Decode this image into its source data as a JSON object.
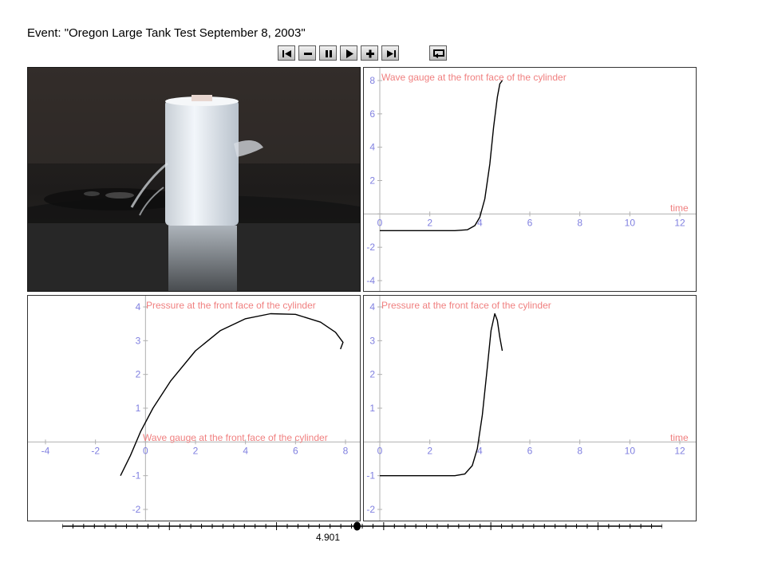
{
  "event_title": "Event: \"Oregon Large Tank Test September 8, 2003\"",
  "toolbar": {
    "buttons": [
      {
        "name": "skip-to-start-button",
        "icon": "skip-start-icon"
      },
      {
        "name": "step-back-button",
        "icon": "minus-icon"
      },
      {
        "name": "pause-button",
        "icon": "pause-icon"
      },
      {
        "name": "play-button",
        "icon": "play-icon"
      },
      {
        "name": "step-forward-button",
        "icon": "plus-icon"
      },
      {
        "name": "skip-to-end-button",
        "icon": "skip-end-icon"
      },
      {
        "name": "loop-button",
        "icon": "loop-icon"
      }
    ]
  },
  "video": {
    "icon": "video-frame"
  },
  "colors": {
    "label": "#f08080",
    "tick": "#8080e0",
    "axis": "#b0b0b0",
    "line": "#000000"
  },
  "slider": {
    "value": "4.901",
    "position": 0.4901
  },
  "chart_data": [
    {
      "id": "top-right",
      "type": "line",
      "title": "Wave gauge at the front face of the cylinder",
      "xlabel": "time",
      "ylabel": "",
      "xlim": [
        0,
        12
      ],
      "ylim": [
        -4,
        8
      ],
      "x_ticks": [
        0,
        2,
        4,
        6,
        8,
        10,
        12
      ],
      "y_ticks": [
        -4,
        -2,
        0,
        2,
        4,
        6,
        8
      ],
      "series": [
        {
          "x": [
            0,
            1,
            2,
            3,
            3.5,
            3.8,
            4.0,
            4.2,
            4.4,
            4.55,
            4.7,
            4.8,
            4.9
          ],
          "y": [
            -1,
            -1,
            -1,
            -1,
            -0.95,
            -0.7,
            -0.2,
            0.9,
            3.0,
            5.2,
            7.0,
            7.8,
            8.0
          ]
        }
      ]
    },
    {
      "id": "bottom-left",
      "type": "line",
      "title": "Pressure at the front face of the cylinder",
      "xlabel": "Wave gauge at the front face of the cylinder",
      "ylabel": "",
      "xlim": [
        -4,
        8
      ],
      "ylim": [
        -2,
        4
      ],
      "x_ticks": [
        -4,
        -2,
        0,
        2,
        4,
        6,
        8
      ],
      "y_ticks": [
        -2,
        -1,
        0,
        1,
        2,
        3,
        4
      ],
      "series": [
        {
          "x": [
            -1.0,
            -0.6,
            -0.2,
            0.3,
            1.0,
            2.0,
            3.0,
            4.0,
            5.0,
            6.0,
            7.0,
            7.6,
            7.9,
            7.8
          ],
          "y": [
            -1.0,
            -0.4,
            0.3,
            1.0,
            1.8,
            2.7,
            3.3,
            3.65,
            3.8,
            3.78,
            3.55,
            3.25,
            2.95,
            2.75
          ]
        }
      ]
    },
    {
      "id": "bottom-right",
      "type": "line",
      "title": "Pressure at the front face of the cylinder",
      "xlabel": "time",
      "ylabel": "",
      "xlim": [
        0,
        12
      ],
      "ylim": [
        -2,
        4
      ],
      "x_ticks": [
        0,
        2,
        4,
        6,
        8,
        10,
        12
      ],
      "y_ticks": [
        -2,
        -1,
        0,
        1,
        2,
        3,
        4
      ],
      "series": [
        {
          "x": [
            0,
            1,
            2,
            3,
            3.4,
            3.7,
            3.9,
            4.1,
            4.3,
            4.45,
            4.6,
            4.7,
            4.8,
            4.9
          ],
          "y": [
            -1,
            -1,
            -1,
            -1,
            -0.95,
            -0.7,
            -0.2,
            0.8,
            2.2,
            3.3,
            3.8,
            3.6,
            3.1,
            2.7
          ]
        }
      ]
    }
  ]
}
